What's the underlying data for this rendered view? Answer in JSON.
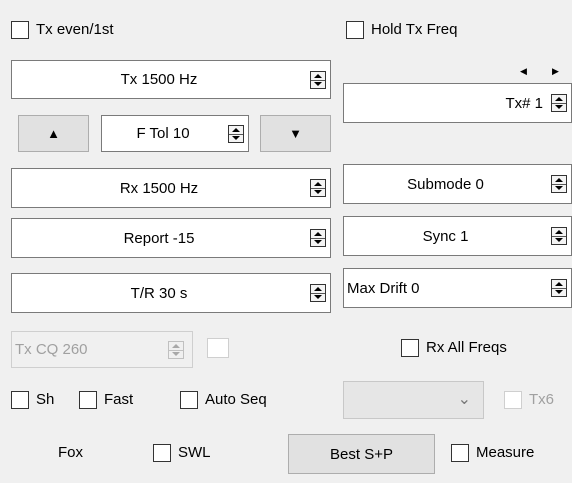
{
  "checkboxes": {
    "tx_even": "Tx even/1st",
    "hold_tx_freq": "Hold Tx Freq",
    "rx_all_freqs": "Rx All Freqs",
    "sh": "Sh",
    "fast": "Fast",
    "auto_seq": "Auto Seq",
    "tx6": "Tx6",
    "swl": "SWL",
    "measure": "Measure"
  },
  "spinboxes": {
    "tx_freq": "Tx  1500  Hz",
    "f_tol": "F Tol  10",
    "rx_freq": "Rx  1500  Hz",
    "report": "Report -15",
    "tr_period": "T/R  30  s",
    "tx_cq": "Tx CQ 260",
    "tx_number": "Tx# 1",
    "submode": "Submode 0",
    "sync": "Sync   1",
    "max_drift": "Max Drift  0"
  },
  "buttons": {
    "up_arrow": "▲",
    "down_arrow": "▼",
    "best_sp": "Best S+P"
  },
  "labels": {
    "fox": "Fox"
  },
  "icons": {
    "nav_left": "◀",
    "nav_right": "▶",
    "combo_chevron": "⌄"
  }
}
